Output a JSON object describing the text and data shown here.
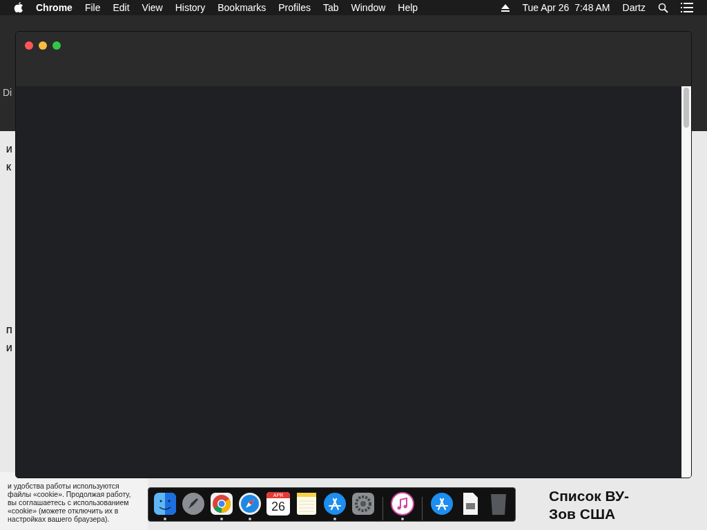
{
  "menu_bar": {
    "app": "Chrome",
    "items": [
      "File",
      "Edit",
      "View",
      "History",
      "Bookmarks",
      "Profiles",
      "Tab",
      "Window",
      "Help"
    ],
    "clock": "Tue Apr 26  7:48 AM",
    "user": "Dartz"
  },
  "background_page": {
    "tab_fragment": "Di",
    "left_fragments": [
      "И",
      "К",
      "П",
      "И"
    ],
    "cookie_notice": "и удобства работы используются файлы «cookie». Продолжая работу, вы соглашаетесь с использованием «cookie» (можете отключить их в настройках вашего браузера).",
    "heading": "Список ВУ-Зов США"
  },
  "window": {
    "kind": "chrome"
  },
  "dock": [
    {
      "kind": "finder",
      "running": true
    },
    {
      "kind": "launchpad",
      "running": false
    },
    {
      "kind": "chrome",
      "running": true
    },
    {
      "kind": "safari",
      "running": true
    },
    {
      "kind": "calendar",
      "running": false,
      "month": "APR",
      "day": "26"
    },
    {
      "kind": "notes",
      "running": false
    },
    {
      "kind": "appstore",
      "running": true
    },
    {
      "kind": "settings",
      "running": false
    },
    {
      "kind": "divider"
    },
    {
      "kind": "music",
      "running": true
    },
    {
      "kind": "divider"
    },
    {
      "kind": "appstore",
      "running": false
    },
    {
      "kind": "file",
      "running": false
    },
    {
      "kind": "trash",
      "running": false
    }
  ]
}
